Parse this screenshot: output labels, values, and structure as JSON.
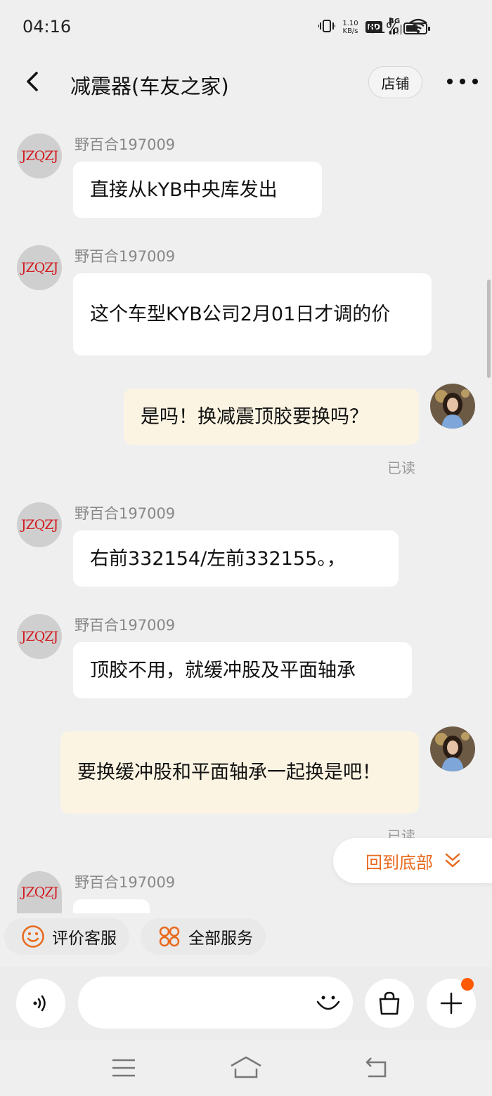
{
  "status": {
    "time": "04:16",
    "speed_value": "1.10",
    "speed_unit": "KB/s",
    "hd": "HD",
    "network": "4G",
    "battery_pct": "61%",
    "battery_level": 0.61
  },
  "header": {
    "title": "减震器(车友之家)",
    "shop_label": "店铺"
  },
  "avatar_text": "JZQZJ",
  "messages": [
    {
      "sender": "野百合197009",
      "text": "直接从kYB中央库发出"
    },
    {
      "sender": "野百合197009",
      "text": "这个车型KYB公司2月01日才调的价"
    },
    {
      "text": "是吗！换减震顶胶要换吗？",
      "status": "已读"
    },
    {
      "sender": "野百合197009",
      "text": "右前332154/左前332155。，"
    },
    {
      "sender": "野百合197009",
      "text": "顶胶不用，就缓冲股及平面轴承"
    },
    {
      "text": "要换缓冲股和平面轴承一起换是吧！",
      "status": "已读"
    },
    {
      "sender": "野百合197009",
      "text": ""
    }
  ],
  "back_to_bottom": "回到底部",
  "quick_actions": {
    "rate": "评价客服",
    "all_services": "全部服务"
  },
  "input": {
    "placeholder": ""
  },
  "colors": {
    "accent": "#e8691c",
    "out_bubble": "#fcf4e2",
    "badge": "#ff5a00",
    "avatar_text": "#d21b20"
  }
}
